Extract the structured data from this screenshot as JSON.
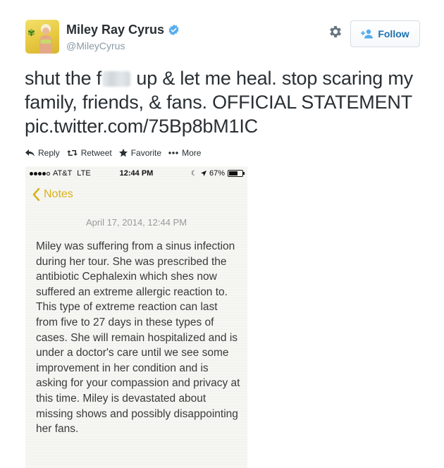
{
  "user": {
    "display_name": "Miley Ray Cyrus",
    "handle": "@MileyCyrus",
    "verified": true
  },
  "follow_button": {
    "label": "Follow",
    "icon": "add-user-icon"
  },
  "settings_icon": "gear-icon",
  "tweet": {
    "text_part1": "shut the f",
    "text_part2": " up & let me heal. stop scaring my family, friends, & fans. OFFICIAL STATEMENT pic.twitter.com/75Bp8bM1IC"
  },
  "actions": [
    {
      "label": "Reply",
      "icon": "reply-icon"
    },
    {
      "label": "Retweet",
      "icon": "retweet-icon"
    },
    {
      "label": "Favorite",
      "icon": "star-icon"
    },
    {
      "label": "More",
      "icon": "more-dots-icon"
    }
  ],
  "phone": {
    "carrier": "AT&T",
    "network": "LTE",
    "time": "12:44 PM",
    "battery": "67%",
    "battery_level": 0.67,
    "back_label": "Notes",
    "note_date": "April 17, 2014, 12:44 PM",
    "note_text": "Miley was suffering from a sinus infection during her tour. She was prescribed the antibiotic Cephalexin which shes now suffered an extreme allergic reaction to. This type of extreme reaction can last from five to 27 days in these types of cases. She will remain hospitalized and is under a doctor's care until we see some improvement in her condition and is asking for your compassion and privacy at this time. Miley is devastated about missing shows and possibly disappointing her fans."
  },
  "colors": {
    "link": "#1b6fb0",
    "verified": "#55acee",
    "notes_accent": "#d8b21a"
  }
}
